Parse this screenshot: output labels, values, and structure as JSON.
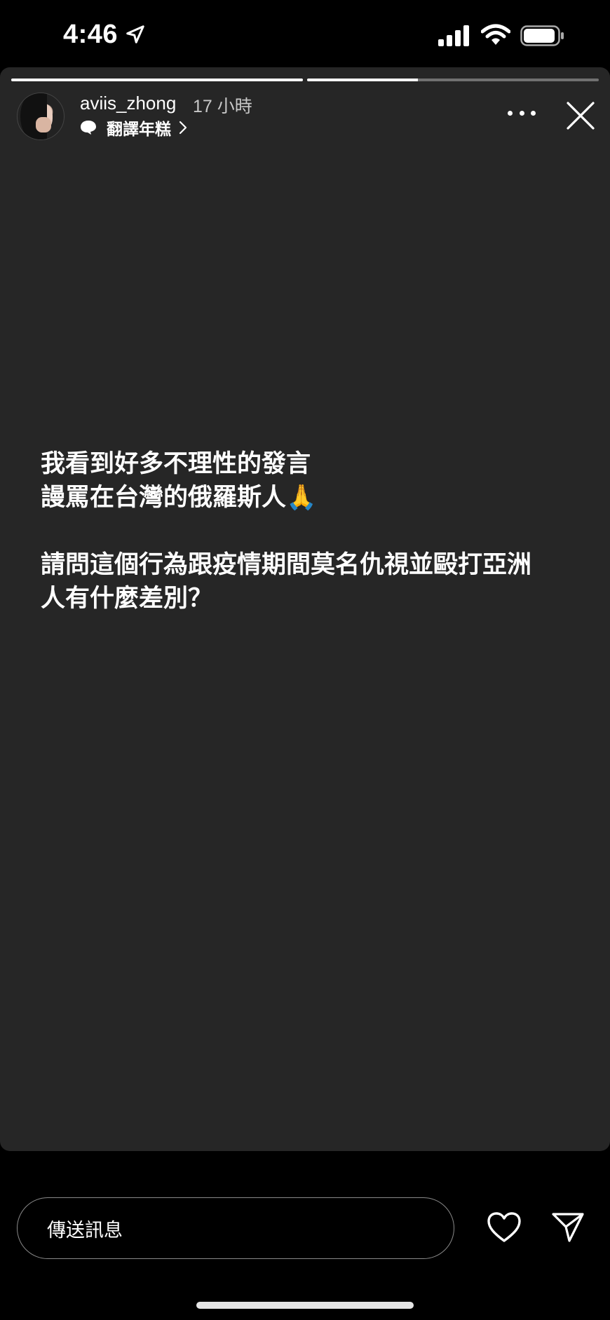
{
  "status_bar": {
    "time": "4:46",
    "icons": [
      "location-arrow-icon",
      "cellular-signal-icon",
      "wifi-icon",
      "battery-icon"
    ]
  },
  "story": {
    "progress": [
      {
        "segment": 1,
        "fill_fraction": 1.0
      },
      {
        "segment": 2,
        "fill_fraction": 0.38
      }
    ],
    "username": "aviis_zhong",
    "time_ago": "17 小時",
    "translate_label": "翻譯年糕",
    "text": "我看到好多不理性的發言\n謾罵在台灣的俄羅斯人🙏\n\n請問這個行為跟疫情期間莫名仇視並毆打亞洲\n人有什麼差別？",
    "background_color": "#262626"
  },
  "footer": {
    "message_placeholder": "傳送訊息"
  }
}
